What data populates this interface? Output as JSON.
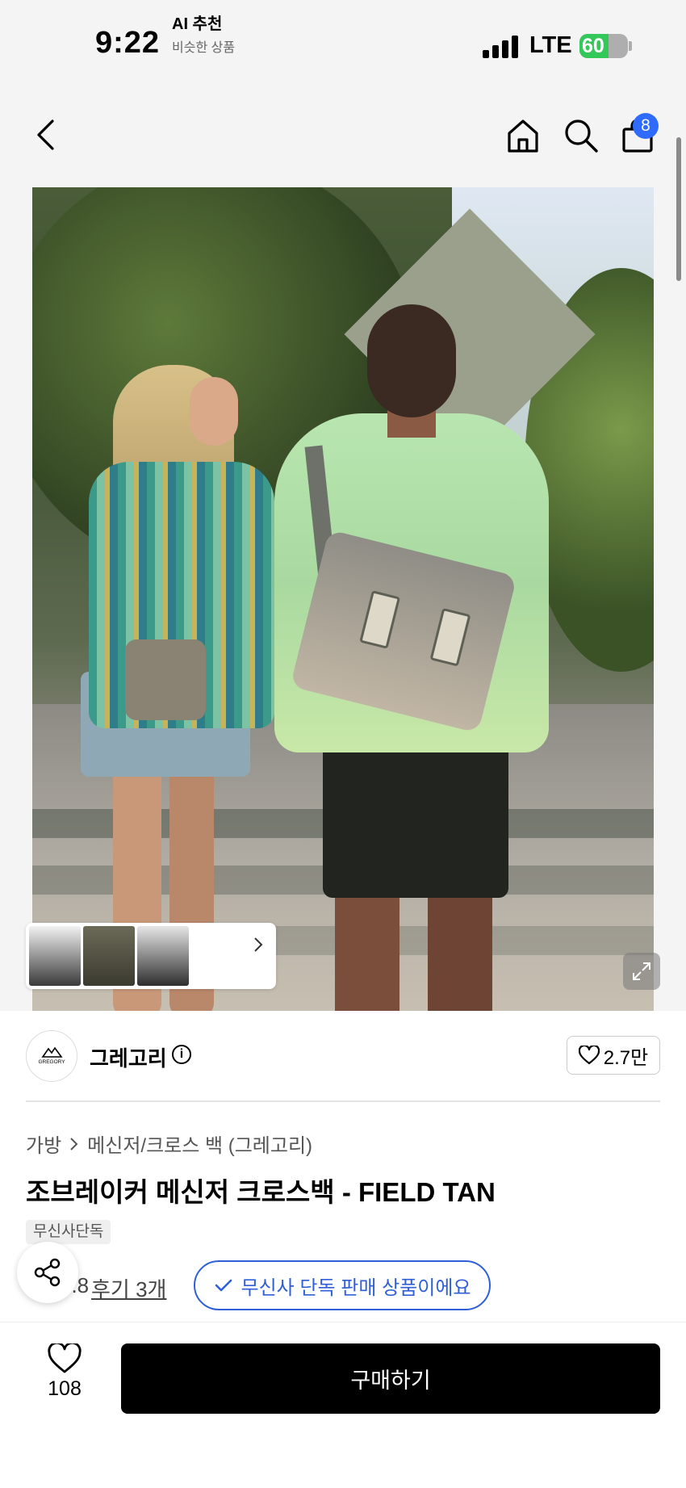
{
  "status_bar": {
    "time": "9:22",
    "network": "LTE",
    "battery": "60",
    "battery_level": 0.6
  },
  "top_nav": {
    "cart_count": "8"
  },
  "ai_recommend": {
    "title": "AI 추천",
    "subtitle": "비슷한 상품"
  },
  "brand": {
    "name": "그레고리",
    "logo_text": "GREGORY",
    "likes": "2.7만"
  },
  "breadcrumb": {
    "category": "가방",
    "subcategory": "메신저/크로스 백 (그레고리)"
  },
  "product": {
    "title": "조브레이커 메신저 크로스백 - FIELD TAN",
    "tag": "무신사단독",
    "rating": "4.8",
    "review_link": "후기 3개",
    "exclusive_note": "무신사 단독 판매 상품이에요"
  },
  "bottom_bar": {
    "wish_count": "108",
    "buy_label": "구매하기"
  },
  "colors": {
    "accent_blue": "#2f5fd8",
    "badge_blue": "#2f6bff",
    "buy_button": "#000000",
    "rating_star": "#f3c623"
  },
  "icons": [
    "back-icon",
    "home-icon",
    "search-icon",
    "bag-icon",
    "chevron-right-icon",
    "expand-icon",
    "info-icon",
    "heart-icon",
    "share-icon",
    "check-icon",
    "star-icon"
  ]
}
